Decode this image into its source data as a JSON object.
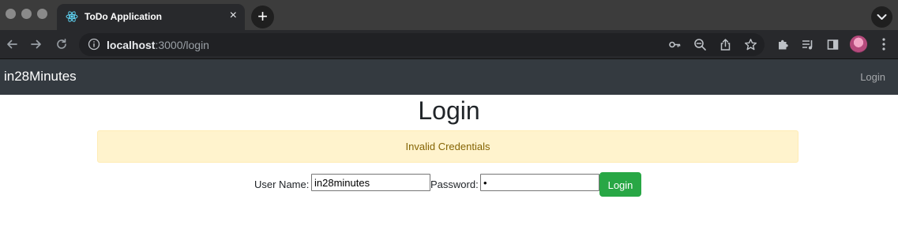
{
  "browser": {
    "tab_title": "ToDo Application",
    "tab_close": "×",
    "new_tab": "+",
    "url_host": "localhost",
    "url_path": ":3000/login",
    "icons": [
      "back-icon",
      "forward-icon",
      "reload-icon",
      "info-icon",
      "key-icon",
      "zoom-out-icon",
      "share-icon",
      "star-icon",
      "extensions-icon",
      "media-icon",
      "side-panel-icon",
      "profile-avatar",
      "menu-kebab-icon",
      "tab-search-icon",
      "react-favicon"
    ]
  },
  "navbar": {
    "brand": "in28Minutes",
    "login_link": "Login"
  },
  "page": {
    "title": "Login",
    "alert": "Invalid Credentials",
    "username_label": "User Name:",
    "username_value": "in28minutes",
    "password_label": "Password:",
    "password_value": "•",
    "login_button": "Login"
  },
  "colors": {
    "navbar_bg": "#343a40",
    "alert_bg": "#fff3cd",
    "alert_text": "#856404",
    "button_bg": "#28a745"
  }
}
